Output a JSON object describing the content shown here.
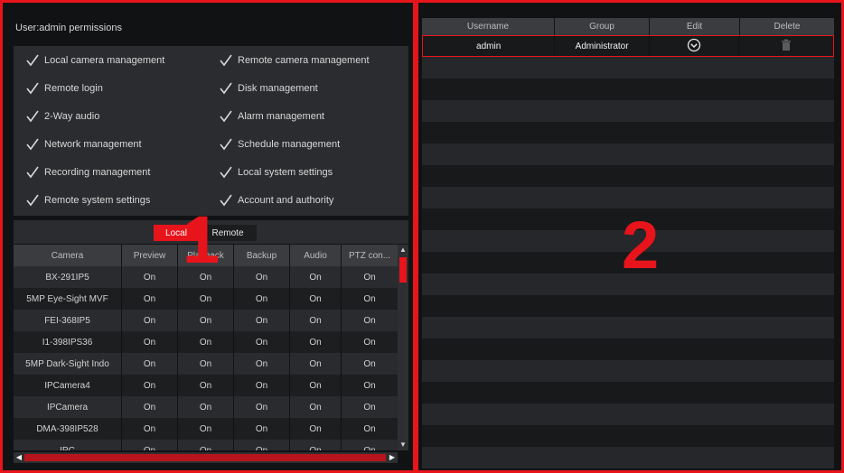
{
  "permissions": {
    "title": "User:admin permissions",
    "left": [
      "Local camera management",
      "Remote login",
      "2-Way audio",
      "Network management",
      "Recording management",
      "Remote system settings"
    ],
    "right": [
      "Remote camera management",
      "Disk management",
      "Alarm management",
      "Schedule management",
      "Local system settings",
      "Account and authority"
    ]
  },
  "tabs": {
    "local": "Local",
    "remote": "Remote"
  },
  "camera_table": {
    "headers": [
      "Camera",
      "Preview",
      "Playback",
      "Backup",
      "Audio",
      "PTZ con..."
    ],
    "rows": [
      [
        "BX-291IP5",
        "On",
        "On",
        "On",
        "On",
        "On"
      ],
      [
        "5MP Eye-Sight MVF",
        "On",
        "On",
        "On",
        "On",
        "On"
      ],
      [
        "FEI-368IP5",
        "On",
        "On",
        "On",
        "On",
        "On"
      ],
      [
        "I1-398IPS36",
        "On",
        "On",
        "On",
        "On",
        "On"
      ],
      [
        "5MP Dark-Sight Indo",
        "On",
        "On",
        "On",
        "On",
        "On"
      ],
      [
        "IPCamera4",
        "On",
        "On",
        "On",
        "On",
        "On"
      ],
      [
        "IPCamera",
        "On",
        "On",
        "On",
        "On",
        "On"
      ],
      [
        "DMA-398IP528",
        "On",
        "On",
        "On",
        "On",
        "On"
      ],
      [
        "IPC",
        "On",
        "On",
        "On",
        "On",
        "On"
      ]
    ]
  },
  "user_table": {
    "headers": [
      "Username",
      "Group",
      "Edit",
      "Delete"
    ],
    "users": [
      {
        "username": "admin",
        "group": "Administrator"
      }
    ]
  },
  "overlay": {
    "left_number": "1",
    "right_number": "2"
  },
  "colors": {
    "accent": "#e8141b",
    "background": "#111214"
  }
}
